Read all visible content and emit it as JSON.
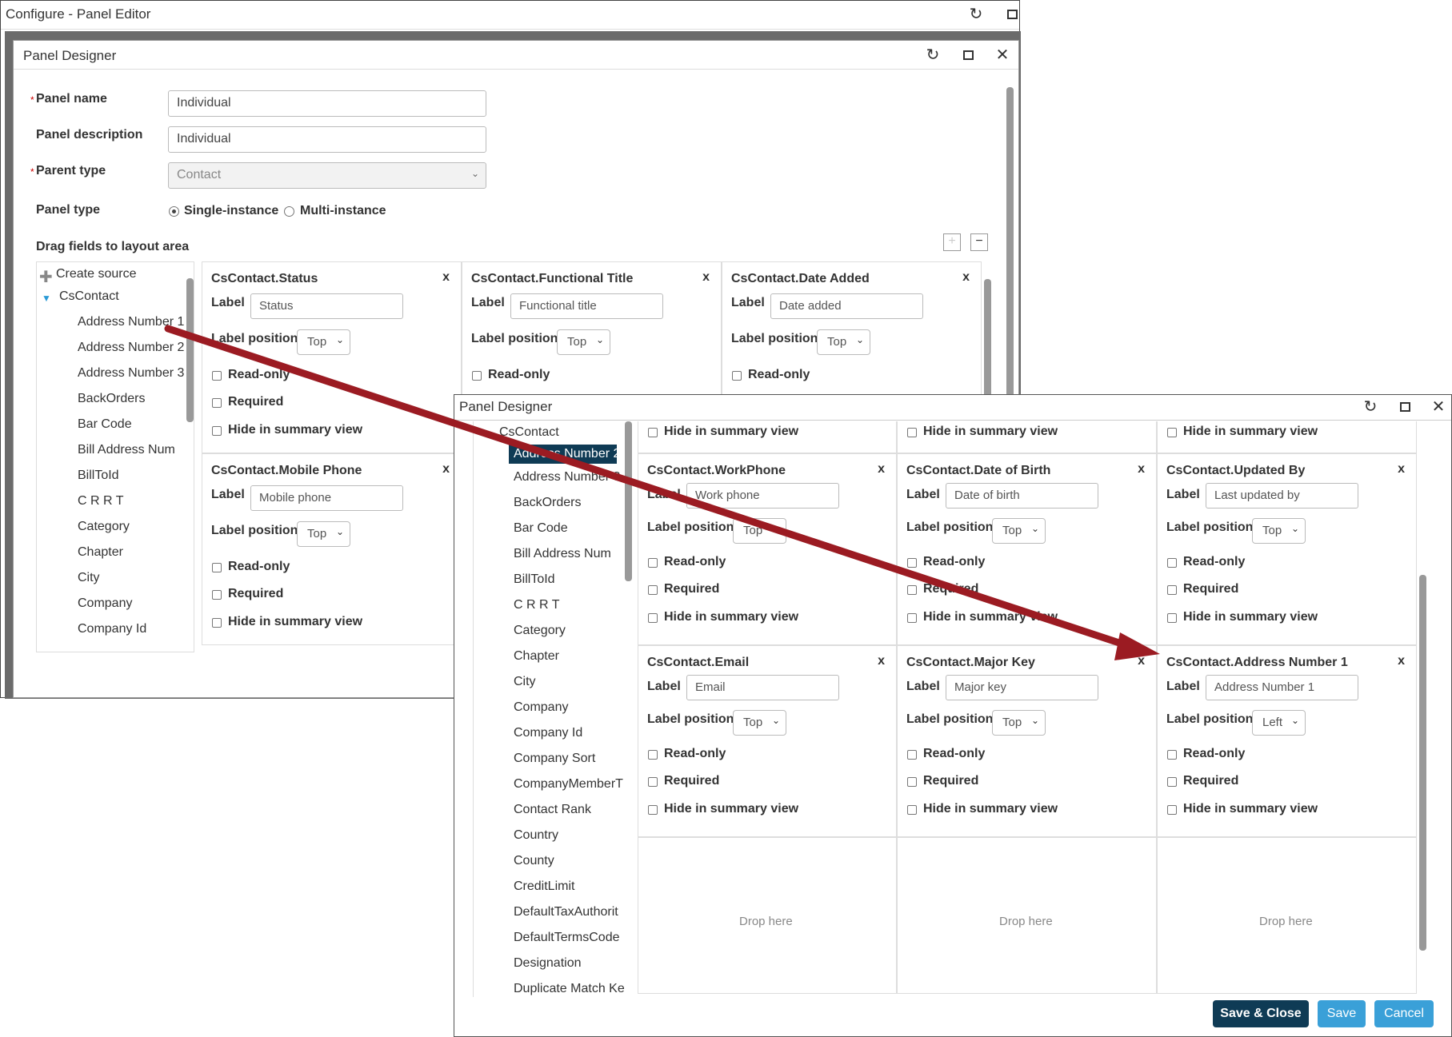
{
  "outer_window": {
    "title": "Configure - Panel Editor"
  },
  "inner_window": {
    "title": "Panel Designer",
    "panel_name_label": "Panel name",
    "panel_name_value": "Individual",
    "panel_description_label": "Panel description",
    "panel_description_value": "Individual",
    "parent_type_label": "Parent type",
    "parent_type_value": "Contact",
    "panel_type_label": "Panel type",
    "panel_type_options": [
      "Single-instance",
      "Multi-instance"
    ],
    "drag_label": "Drag fields to layout area",
    "tree": {
      "create_source": "Create source",
      "root": "CsContact",
      "items": [
        "Address Number 1",
        "Address Number 2",
        "Address Number 3",
        "BackOrders",
        "Bar Code",
        "Bill Address Num",
        "BillToId",
        "C R R T",
        "Category",
        "Chapter",
        "City",
        "Company",
        "Company Id"
      ]
    },
    "cards": [
      {
        "title": "CsContact.Status",
        "label_value": "Status",
        "position": "Top"
      },
      {
        "title": "CsContact.Functional Title",
        "label_value": "Functional title",
        "position": "Top"
      },
      {
        "title": "CsContact.Date Added",
        "label_value": "Date added",
        "position": "Top"
      },
      {
        "title": "CsContact.Mobile Phone",
        "label_value": "Mobile phone",
        "position": "Top"
      }
    ]
  },
  "common": {
    "label": "Label",
    "label_position": "Label position",
    "read_only": "Read-only",
    "required": "Required",
    "hide_summary": "Hide in summary view",
    "close_x": "x",
    "drop_here": "Drop here"
  },
  "front_window": {
    "title": "Panel Designer",
    "tree_root": "CsContact",
    "tree_items": [
      "Address Number 2",
      "Address Number 3",
      "BackOrders",
      "Bar Code",
      "Bill Address Num",
      "BillToId",
      "C R R T",
      "Category",
      "Chapter",
      "City",
      "Company",
      "Company Id",
      "Company Sort",
      "CompanyMemberT",
      "Contact Rank",
      "Country",
      "County",
      "CreditLimit",
      "DefaultTaxAuthorit",
      "DefaultTermsCode",
      "Designation",
      "Duplicate Match Ke"
    ],
    "cards": [
      {
        "title": "CsContact.WorkPhone",
        "label_value": "Work phone",
        "position": "Top"
      },
      {
        "title": "CsContact.Date of Birth",
        "label_value": "Date of birth",
        "position": "Top"
      },
      {
        "title": "CsContact.Updated By",
        "label_value": "Last updated by",
        "position": "Top"
      },
      {
        "title": "CsContact.Email",
        "label_value": "Email",
        "position": "Top"
      },
      {
        "title": "CsContact.Major Key",
        "label_value": "Major key",
        "position": "Top"
      },
      {
        "title": "CsContact.Address Number 1",
        "label_value": "Address Number 1",
        "position": "Left"
      }
    ],
    "buttons": {
      "save_close": "Save & Close",
      "save": "Save",
      "cancel": "Cancel"
    }
  },
  "colors": {
    "arrow": "#9b1b22",
    "primary_button": "#0f3b55",
    "secondary_button": "#3aa0d8"
  }
}
